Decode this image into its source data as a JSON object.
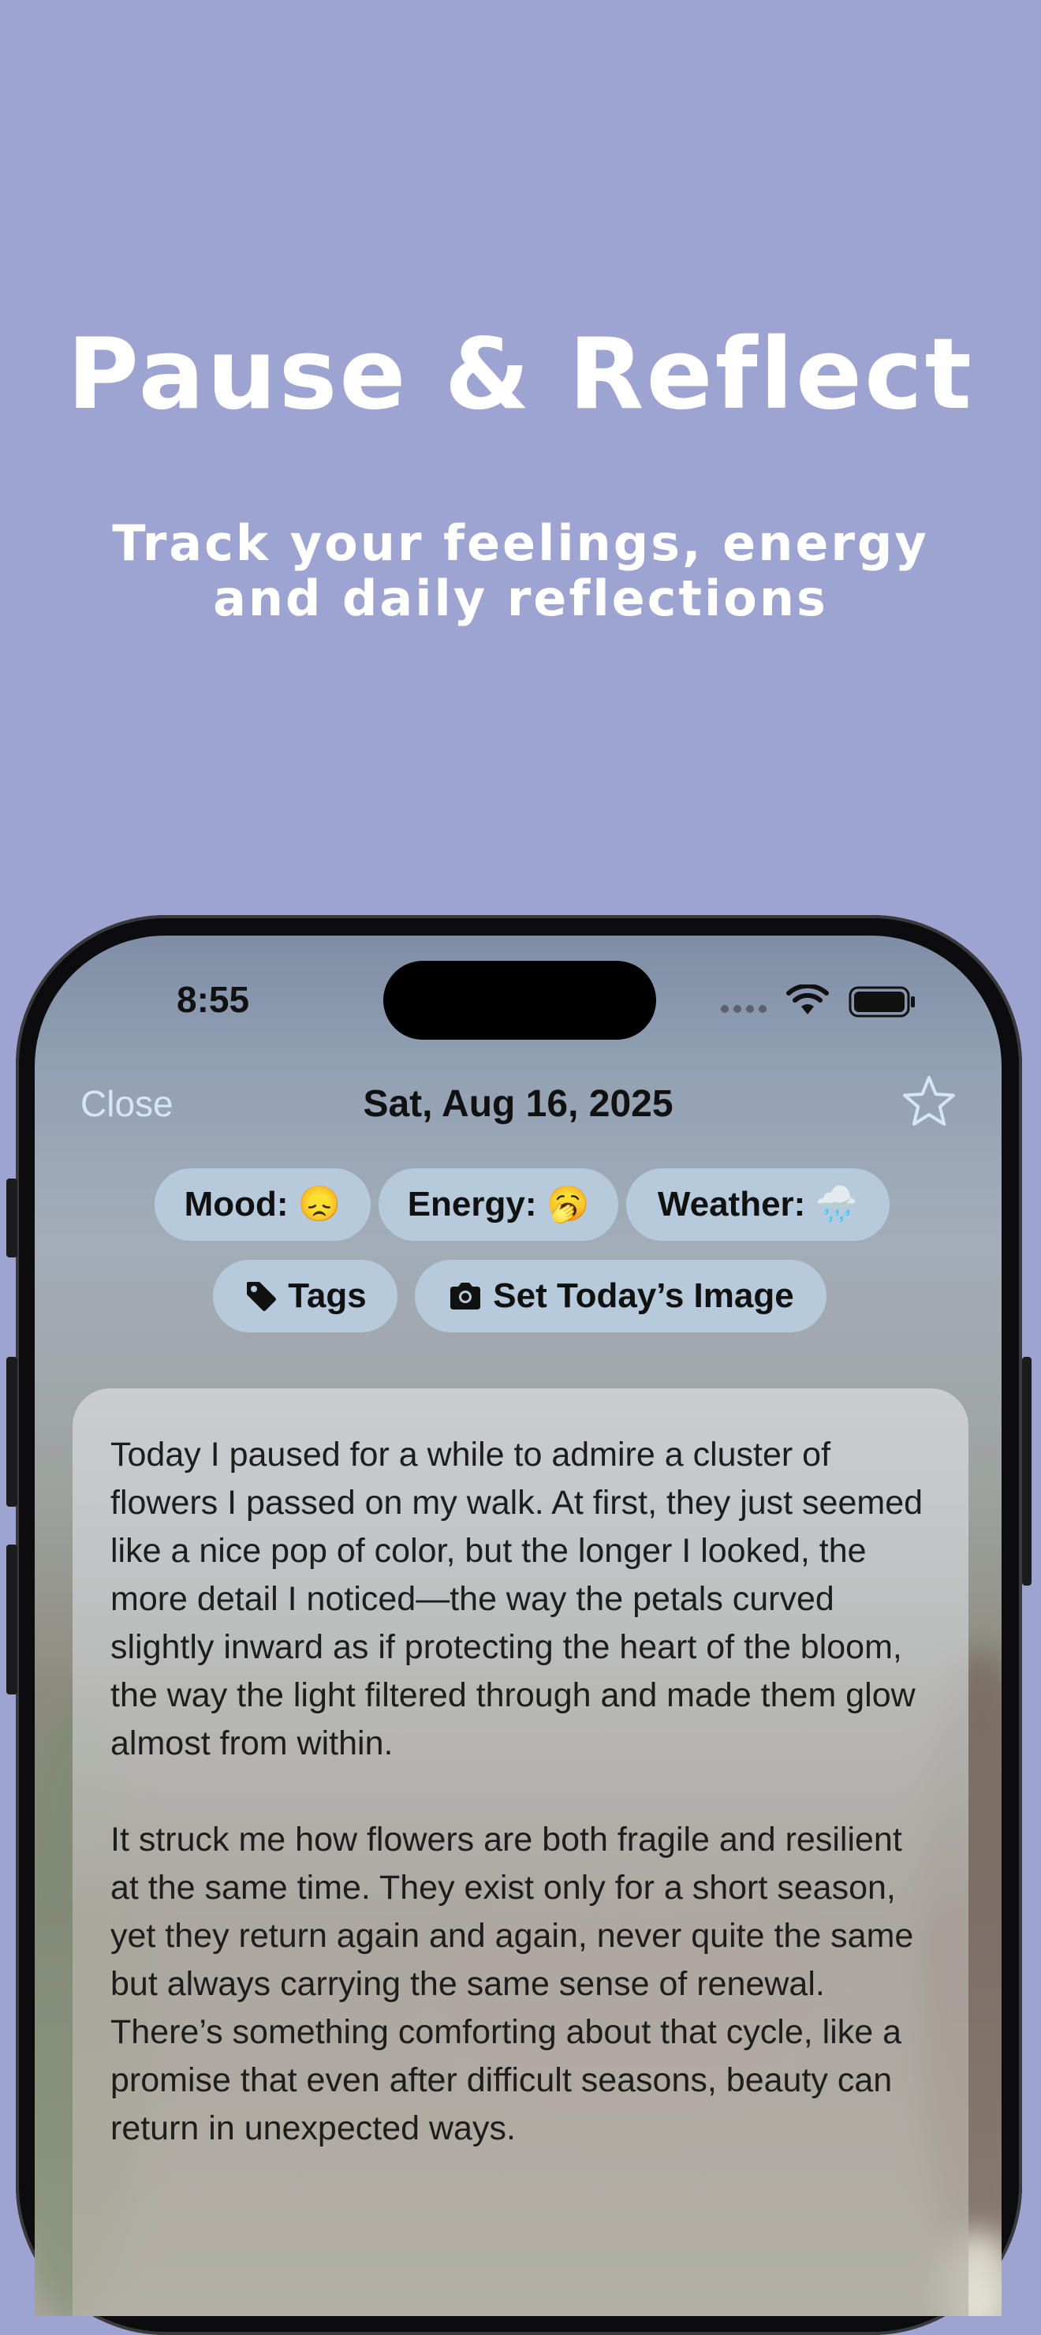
{
  "hero": {
    "title": "Pause & Reflect",
    "subtitle": "Track your feelings, energy and daily reflections"
  },
  "status_bar": {
    "time": "8:55",
    "icons": [
      "signal-dots-icon",
      "wifi-icon",
      "battery-icon"
    ]
  },
  "nav": {
    "close_label": "Close",
    "date": "Sat, Aug 16, 2025",
    "favorite_icon": "star-outline-icon"
  },
  "chips": {
    "mood": {
      "label": "Mood:",
      "emoji": "😞"
    },
    "energy": {
      "label": "Energy:",
      "emoji": "🥱"
    },
    "weather": {
      "label": "Weather:",
      "emoji": "🌧️"
    },
    "tags": {
      "label": "Tags",
      "icon": "tag-icon"
    },
    "image": {
      "label": "Set Today’s Image",
      "icon": "camera-icon"
    }
  },
  "entry": {
    "paragraphs": [
      "Today I paused for a while to admire a cluster of flowers I passed on my walk. At first, they just seemed like a nice pop of color, but the longer I looked, the more detail I noticed—the way the petals curved slightly inward as if protecting the heart of the bloom, the way the light filtered through and made them glow almost from within.",
      "It struck me how flowers are both fragile and resilient at the same time. They exist only for a short season, yet they return again and again, never quite the same but always carrying the same sense of renewal. There’s something comforting about that cycle, like a promise that even after difficult seasons, beauty can return in unexpected ways."
    ]
  },
  "colors": {
    "background": "#9ea4d2",
    "chip": "#b6cadc",
    "close_text": "#d6e6f6"
  }
}
